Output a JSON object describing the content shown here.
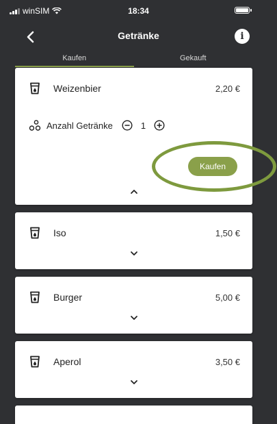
{
  "status": {
    "carrier": "winSIM",
    "time": "18:34"
  },
  "header": {
    "title": "Getränke"
  },
  "tabs": [
    {
      "label": "Kaufen",
      "active": true
    },
    {
      "label": "Gekauft",
      "active": false
    }
  ],
  "items": [
    {
      "name": "Weizenbier",
      "price": "2,20 €",
      "expanded": true,
      "qty_label": "Anzahl Getränke",
      "qty": "1",
      "buy_label": "Kaufen"
    },
    {
      "name": "Iso",
      "price": "1,50 €",
      "expanded": false
    },
    {
      "name": "Burger",
      "price": "5,00 €",
      "expanded": false
    },
    {
      "name": "Aperol",
      "price": "3,50 €",
      "expanded": false
    }
  ],
  "colors": {
    "accent": "#8aa04a",
    "background": "#2f3033",
    "annotation": "#7e9a3e"
  }
}
